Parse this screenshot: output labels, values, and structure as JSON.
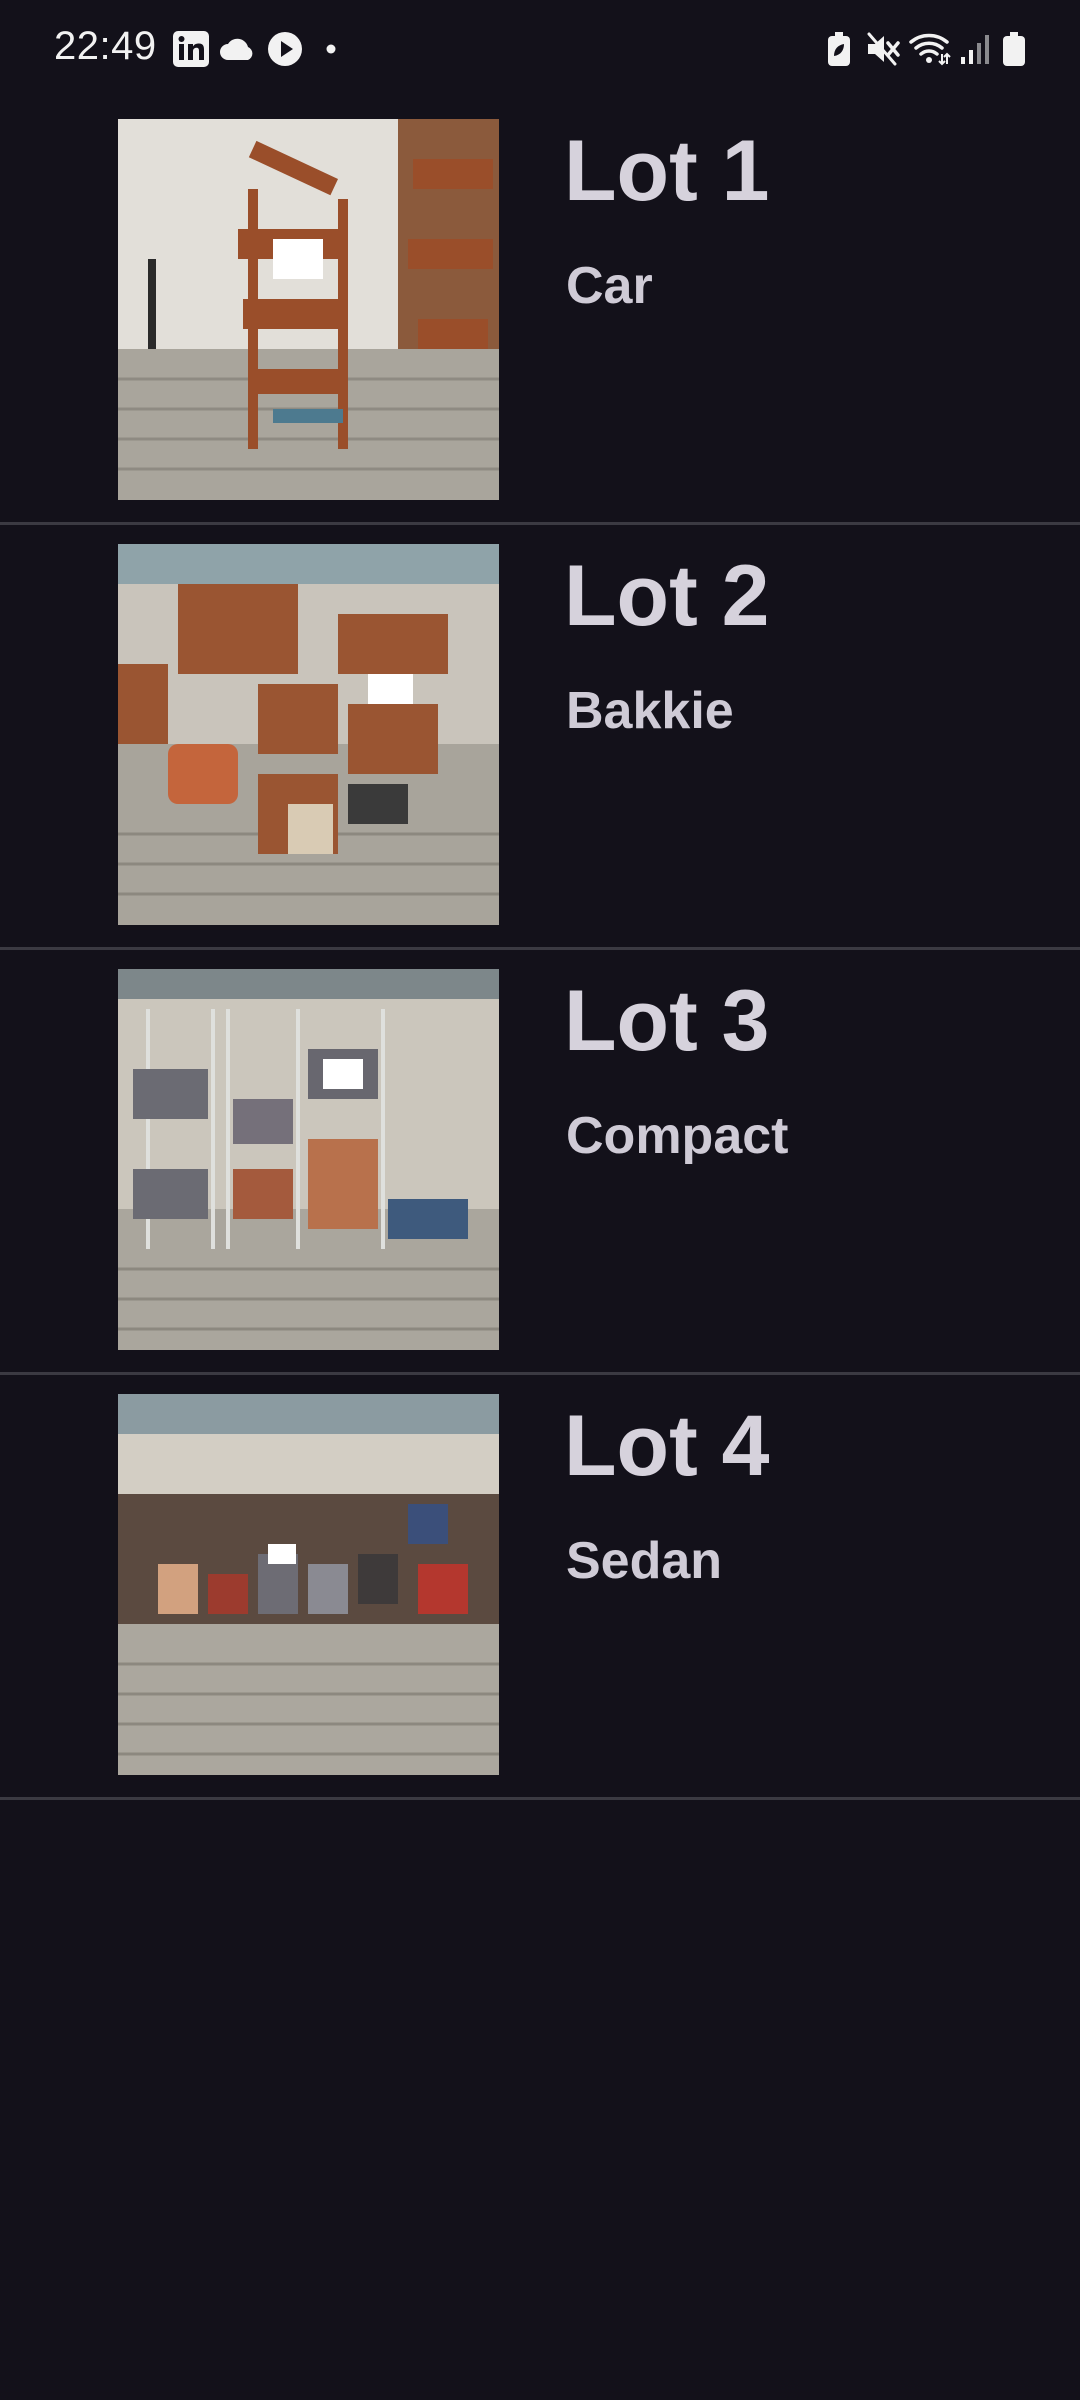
{
  "status_bar": {
    "time": "22:49",
    "left_icons": [
      "linkedin-icon",
      "cloud-icon",
      "play-icon",
      "dot-icon"
    ],
    "right_icons": [
      "battery-saver-icon",
      "mute-icon",
      "wifi-icon",
      "signal-icon",
      "battery-icon"
    ]
  },
  "lots": [
    {
      "title": "Lot 1",
      "subtitle": "Car"
    },
    {
      "title": "Lot 2",
      "subtitle": "Bakkie"
    },
    {
      "title": "Lot 3",
      "subtitle": "Compact"
    },
    {
      "title": "Lot 4",
      "subtitle": "Sedan"
    }
  ],
  "colors": {
    "background": "#13111a",
    "divider": "#3b3a42",
    "text": "#d6d2dc"
  }
}
